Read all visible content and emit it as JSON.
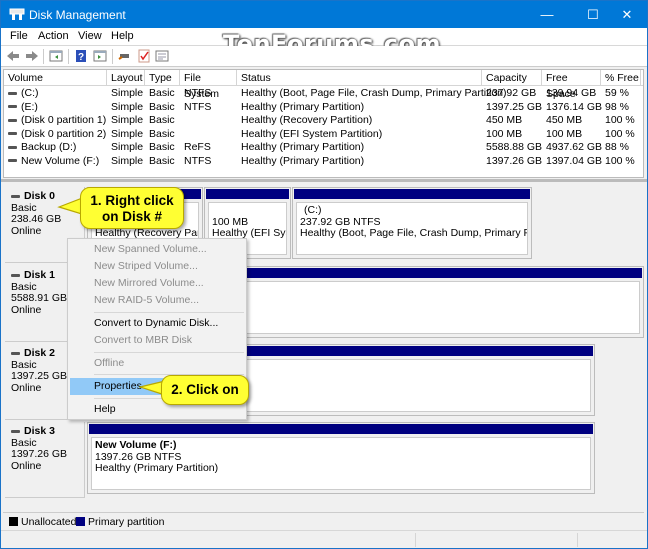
{
  "window": {
    "title": "Disk Management",
    "controls": {
      "minimize": "—",
      "maximize": "☐",
      "close": "✕"
    }
  },
  "watermark": "TenForums.com",
  "menu": [
    "File",
    "Action",
    "View",
    "Help"
  ],
  "toolbar": {
    "icons": [
      "back-icon",
      "forward-icon",
      "console-tree-icon",
      "help-icon",
      "action-pane-icon",
      "connect-icon",
      "check-icon",
      "properties-list-icon"
    ]
  },
  "volumes": {
    "columns": [
      "Volume",
      "Layout",
      "Type",
      "File System",
      "Status",
      "Capacity",
      "Free Space",
      "% Free"
    ],
    "rows": [
      {
        "volume": "(C:)",
        "layout": "Simple",
        "type": "Basic",
        "fs": "NTFS",
        "status": "Healthy (Boot, Page File, Crash Dump, Primary Partition)",
        "capacity": "237.92 GB",
        "free": "139.94 GB",
        "pct": "59 %"
      },
      {
        "volume": "(E:)",
        "layout": "Simple",
        "type": "Basic",
        "fs": "NTFS",
        "status": "Healthy (Primary Partition)",
        "capacity": "1397.25 GB",
        "free": "1376.14 GB",
        "pct": "98 %"
      },
      {
        "volume": "(Disk 0 partition 1)",
        "layout": "Simple",
        "type": "Basic",
        "fs": "",
        "status": "Healthy (Recovery Partition)",
        "capacity": "450 MB",
        "free": "450 MB",
        "pct": "100 %"
      },
      {
        "volume": "(Disk 0 partition 2)",
        "layout": "Simple",
        "type": "Basic",
        "fs": "",
        "status": "Healthy (EFI System Partition)",
        "capacity": "100 MB",
        "free": "100 MB",
        "pct": "100 %"
      },
      {
        "volume": "Backup (D:)",
        "layout": "Simple",
        "type": "Basic",
        "fs": "ReFS",
        "status": "Healthy (Primary Partition)",
        "capacity": "5588.88 GB",
        "free": "4937.62 GB",
        "pct": "88 %"
      },
      {
        "volume": "New Volume (F:)",
        "layout": "Simple",
        "type": "Basic",
        "fs": "NTFS",
        "status": "Healthy (Primary Partition)",
        "capacity": "1397.26 GB",
        "free": "1397.04 GB",
        "pct": "100 %"
      }
    ]
  },
  "disks": [
    {
      "name": "Disk 0",
      "type": "Basic",
      "size": "238.46 GB",
      "state": "Online",
      "partitions": [
        {
          "line1": "",
          "line2": "",
          "line3": "Healthy (Recovery Partiti"
        },
        {
          "line1": "",
          "line2": "100 MB",
          "line3": "Healthy (EFI Syster"
        },
        {
          "line1": "(C:)",
          "line2": "237.92 GB NTFS",
          "line3": "Healthy (Boot, Page File, Crash Dump, Primary Partitio"
        }
      ]
    },
    {
      "name": "Disk 1",
      "type": "Basic",
      "size": "5588.91 GB",
      "state": "Online",
      "partitions": [
        {
          "line1": "",
          "line2": "",
          "line3": ""
        }
      ]
    },
    {
      "name": "Disk 2",
      "type": "Basic",
      "size": "1397.25 GB",
      "state": "Online",
      "partitions": [
        {
          "line1": "",
          "line2": "",
          "line3": ""
        }
      ]
    },
    {
      "name": "Disk 3",
      "type": "Basic",
      "size": "1397.26 GB",
      "state": "Online",
      "partitions": [
        {
          "line1": "New Volume  (F:)",
          "line2": "1397.26 GB NTFS",
          "line3": "Healthy (Primary Partition)"
        }
      ]
    }
  ],
  "context_menu": [
    {
      "label": "New Spanned Volume...",
      "enabled": false
    },
    {
      "label": "New Striped Volume...",
      "enabled": false
    },
    {
      "label": "New Mirrored Volume...",
      "enabled": false
    },
    {
      "label": "New RAID-5 Volume...",
      "enabled": false
    },
    {
      "label": "Convert to Dynamic Disk...",
      "enabled": true
    },
    {
      "label": "Convert to MBR Disk",
      "enabled": false
    },
    {
      "label": "Offline",
      "enabled": false
    },
    {
      "label": "Properties",
      "enabled": true,
      "highlighted": true
    },
    {
      "label": "Help",
      "enabled": true
    }
  ],
  "callouts": {
    "step1_line1": "1. Right click",
    "step1_line2": "on Disk #",
    "step2": "2. Click on"
  },
  "legend": [
    {
      "label": "Unallocated",
      "color": "#000000"
    },
    {
      "label": "Primary partition",
      "color": "#000080"
    }
  ],
  "colors": {
    "titlebar": "#0078d7",
    "partition_bar": "#000080",
    "menu_highlight": "#91c9f7",
    "callout": "#ffff33"
  }
}
